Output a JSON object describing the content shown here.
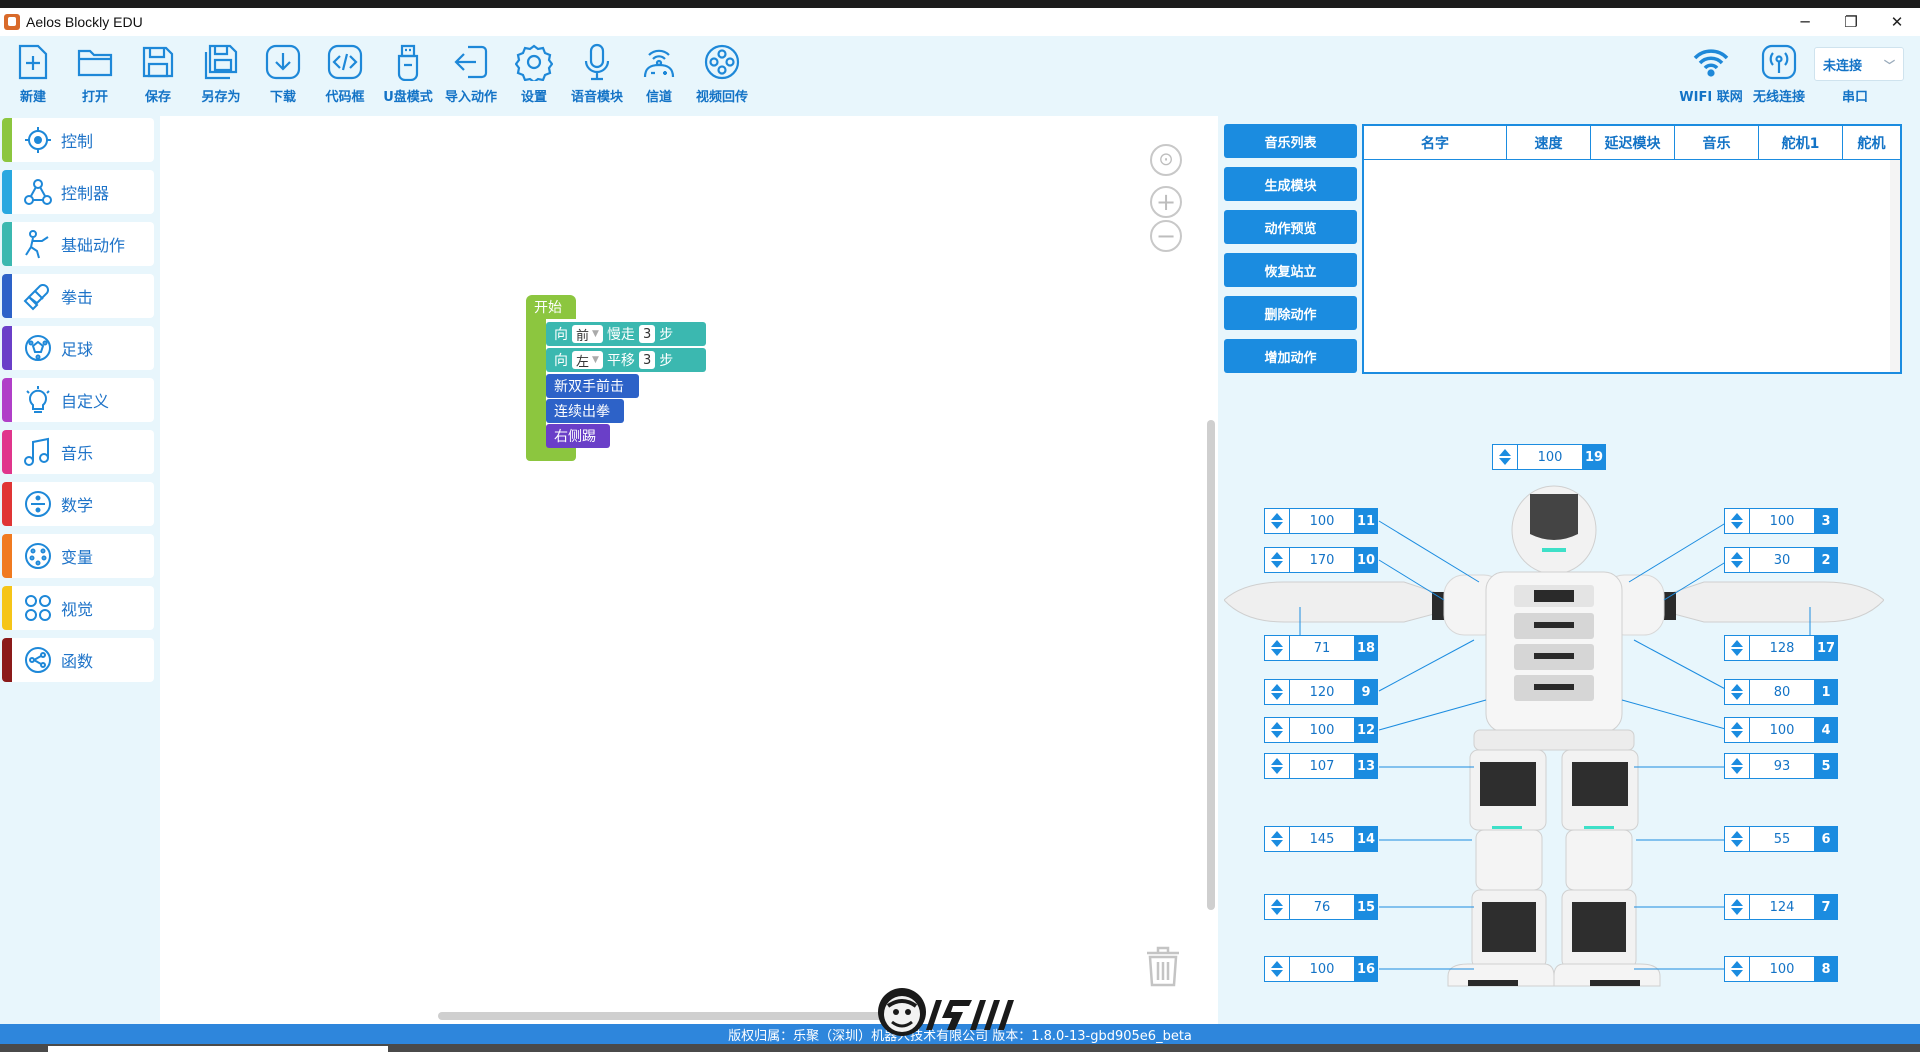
{
  "window": {
    "title": "Aelos Blockly EDU",
    "minimize": "─",
    "restore": "❐",
    "close": "✕"
  },
  "toolbar": {
    "items": [
      {
        "label": "新建",
        "icon": "new-file-icon"
      },
      {
        "label": "打开",
        "icon": "open-folder-icon"
      },
      {
        "label": "保存",
        "icon": "save-icon"
      },
      {
        "label": "另存为",
        "icon": "save-as-icon"
      },
      {
        "label": "下载",
        "icon": "download-icon"
      },
      {
        "label": "代码框",
        "icon": "code-icon"
      },
      {
        "label": "U盘模式",
        "icon": "usb-icon"
      },
      {
        "label": "导入动作",
        "icon": "import-icon"
      },
      {
        "label": "设置",
        "icon": "gear-icon"
      },
      {
        "label": "语音模块",
        "icon": "microphone-icon"
      },
      {
        "label": "信道",
        "icon": "channel-icon"
      },
      {
        "label": "视频回传",
        "icon": "video-icon"
      }
    ],
    "wifi_label": "WIFI 联网",
    "wireless_label": "无线连接",
    "connection_value": "未连接",
    "serial_label": "串口"
  },
  "sidebar": {
    "categories": [
      {
        "label": "控制",
        "color": "#8cc63f",
        "icon": "control-icon"
      },
      {
        "label": "控制器",
        "color": "#29a8e0",
        "icon": "controller-icon"
      },
      {
        "label": "基础动作",
        "color": "#3bb8b0",
        "icon": "basic-action-icon"
      },
      {
        "label": "拳击",
        "color": "#2d62c8",
        "icon": "boxing-icon"
      },
      {
        "label": "足球",
        "color": "#6a3fc8",
        "icon": "football-icon"
      },
      {
        "label": "自定义",
        "color": "#b03fc8",
        "icon": "lightbulb-icon"
      },
      {
        "label": "音乐",
        "color": "#e0358c",
        "icon": "music-icon"
      },
      {
        "label": "数学",
        "color": "#e03535",
        "icon": "math-divide-icon"
      },
      {
        "label": "变量",
        "color": "#f07a20",
        "icon": "variable-icon"
      },
      {
        "label": "视觉",
        "color": "#f5c518",
        "icon": "vision-icon"
      },
      {
        "label": "函数",
        "color": "#8b1a1a",
        "icon": "function-icon"
      }
    ]
  },
  "blocks": {
    "start": "开始",
    "walk": {
      "prefix": "向",
      "dir": "前",
      "action": "慢走",
      "steps": "3",
      "unit": "步"
    },
    "shift": {
      "prefix": "向",
      "dir": "左",
      "action": "平移",
      "steps": "3",
      "unit": "步"
    },
    "punch1": "新双手前击",
    "punch2": "连续出拳",
    "kick": "右侧踢"
  },
  "actions": {
    "buttons": [
      "音乐列表",
      "生成模块",
      "动作预览",
      "恢复站立",
      "删除动作",
      "增加动作"
    ]
  },
  "music_table": {
    "columns": [
      "名字",
      "速度",
      "延迟模块",
      "音乐",
      "舵机1",
      "舵机"
    ]
  },
  "servos": [
    {
      "id": "19",
      "value": "100"
    },
    {
      "id": "11",
      "value": "100"
    },
    {
      "id": "10",
      "value": "170"
    },
    {
      "id": "18",
      "value": "71"
    },
    {
      "id": "9",
      "value": "120"
    },
    {
      "id": "12",
      "value": "100"
    },
    {
      "id": "13",
      "value": "107"
    },
    {
      "id": "14",
      "value": "145"
    },
    {
      "id": "15",
      "value": "76"
    },
    {
      "id": "16",
      "value": "100"
    },
    {
      "id": "3",
      "value": "100"
    },
    {
      "id": "2",
      "value": "30"
    },
    {
      "id": "17",
      "value": "128"
    },
    {
      "id": "1",
      "value": "80"
    },
    {
      "id": "4",
      "value": "100"
    },
    {
      "id": "5",
      "value": "93"
    },
    {
      "id": "6",
      "value": "55"
    },
    {
      "id": "7",
      "value": "124"
    },
    {
      "id": "8",
      "value": "100"
    }
  ],
  "status": {
    "text": "版权归属：乐聚（深圳）机器人技术有限公司 版本：1.8.0-13-gbd905e6_beta"
  },
  "colors": {
    "accent": "#1b8ce0",
    "background": "#e8f6fc",
    "status_bar": "#2e86dc"
  }
}
